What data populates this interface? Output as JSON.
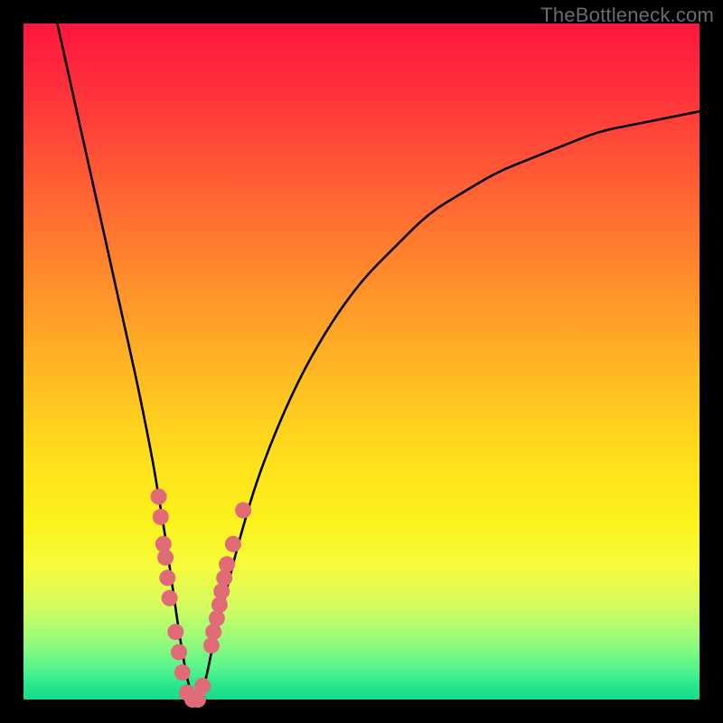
{
  "watermark": "TheBottleneck.com",
  "chart_data": {
    "type": "line",
    "title": "",
    "xlabel": "",
    "ylabel": "",
    "xlim": [
      0,
      100
    ],
    "ylim": [
      0,
      100
    ],
    "series": [
      {
        "name": "bottleneck-curve",
        "x": [
          5,
          7,
          9,
          11,
          13,
          15,
          17,
          19,
          20,
          21,
          22,
          23,
          24,
          25,
          26,
          27,
          28,
          30,
          32,
          35,
          40,
          45,
          50,
          55,
          60,
          65,
          70,
          75,
          80,
          85,
          90,
          95,
          100
        ],
        "y": [
          100,
          91,
          82,
          73,
          64,
          55,
          46,
          36,
          30,
          24,
          17,
          10,
          4,
          0,
          0,
          3,
          8,
          16,
          24,
          34,
          46,
          55,
          62,
          67,
          72,
          75,
          78,
          80,
          82,
          84,
          85,
          86,
          87
        ]
      }
    ],
    "markers": {
      "name": "data-points",
      "color": "#e06b77",
      "points": [
        {
          "x": 20.0,
          "y": 30
        },
        {
          "x": 20.3,
          "y": 27
        },
        {
          "x": 20.7,
          "y": 23
        },
        {
          "x": 21.0,
          "y": 21
        },
        {
          "x": 21.3,
          "y": 18
        },
        {
          "x": 21.6,
          "y": 15
        },
        {
          "x": 22.5,
          "y": 10
        },
        {
          "x": 23.0,
          "y": 7
        },
        {
          "x": 23.5,
          "y": 4
        },
        {
          "x": 24.2,
          "y": 1
        },
        {
          "x": 25.0,
          "y": 0
        },
        {
          "x": 25.8,
          "y": 0
        },
        {
          "x": 26.5,
          "y": 2
        },
        {
          "x": 27.8,
          "y": 8
        },
        {
          "x": 28.1,
          "y": 10
        },
        {
          "x": 28.6,
          "y": 12
        },
        {
          "x": 29.0,
          "y": 14
        },
        {
          "x": 29.3,
          "y": 16
        },
        {
          "x": 29.7,
          "y": 18
        },
        {
          "x": 30.1,
          "y": 20
        },
        {
          "x": 31.0,
          "y": 23
        },
        {
          "x": 32.5,
          "y": 28
        }
      ]
    }
  }
}
